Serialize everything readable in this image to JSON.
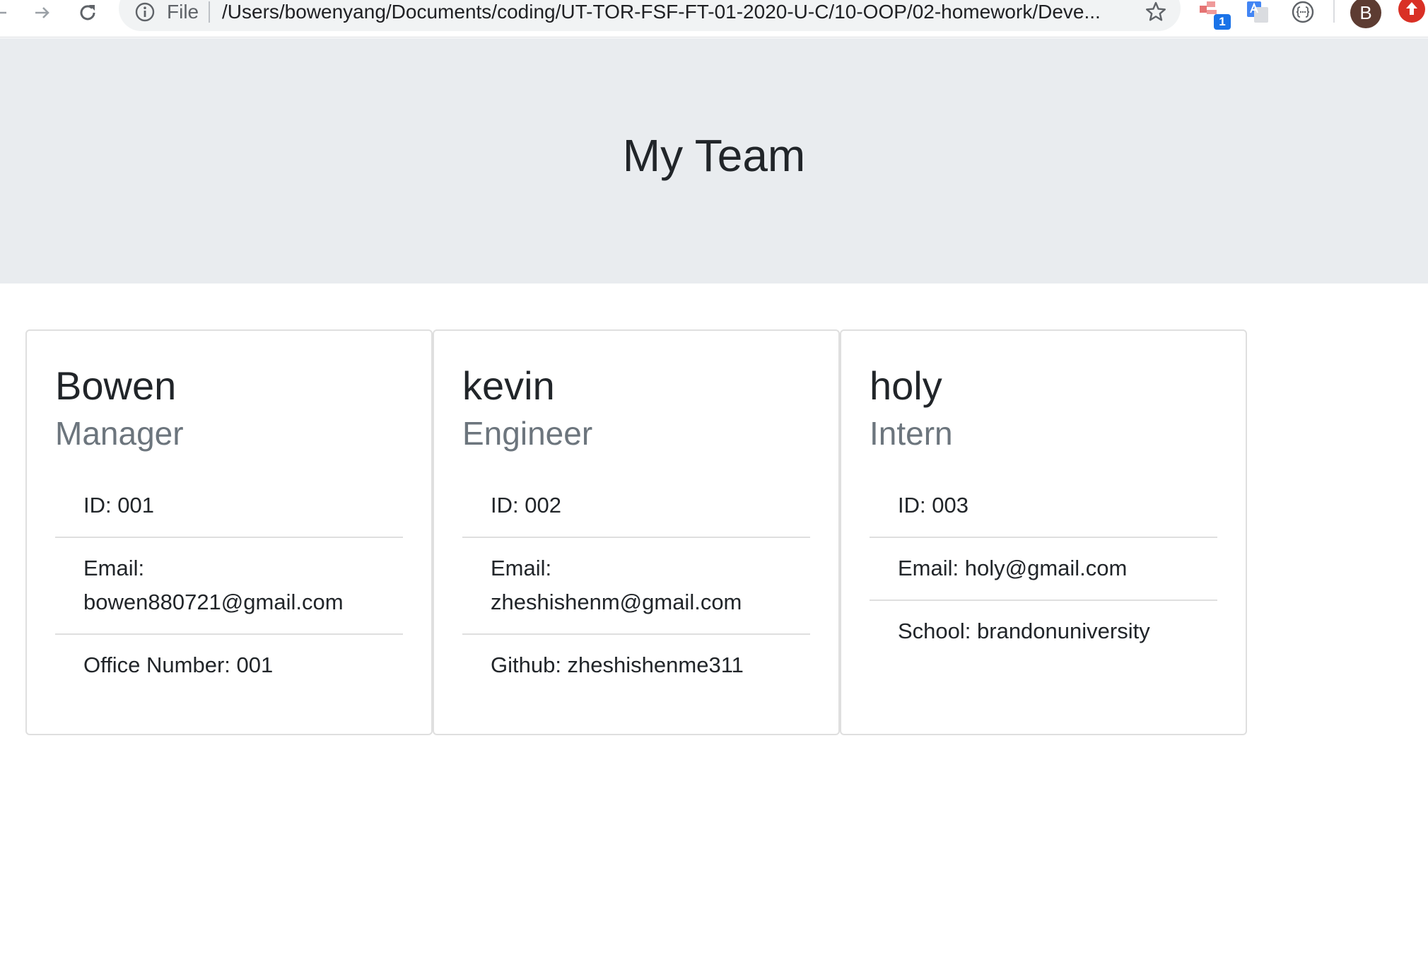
{
  "browser": {
    "scheme_label": "File",
    "url": "/Users/bowenyang/Documents/coding/UT-TOR-FSF-FT-01-2020-U-C/10-OOP/02-homework/Deve...",
    "extension_badge": "1",
    "profile_initial": "B",
    "icons": [
      "back-arrow-icon",
      "forward-arrow-icon",
      "reload-icon",
      "info-icon",
      "star-icon",
      "extension-icon",
      "translate-icon",
      "json-icon",
      "update-icon"
    ]
  },
  "header": {
    "title": "My Team"
  },
  "team": [
    {
      "name": "Bowen",
      "role": "Manager",
      "details": [
        "ID: 001",
        "Email: bowen880721@gmail.com",
        "Office Number: 001"
      ]
    },
    {
      "name": "kevin",
      "role": "Engineer",
      "details": [
        "ID: 002",
        "Email: zheshishenm@gmail.com",
        "Github: zheshishenme311"
      ]
    },
    {
      "name": "holy",
      "role": "Intern",
      "details": [
        "ID: 003",
        "Email: holy@gmail.com",
        "School: brandonuniversity"
      ]
    }
  ],
  "colors": {
    "jumbotron_bg": "#e9ecef",
    "role_text": "#6c757d",
    "body_text": "#212529",
    "card_border": "#dfdfdf"
  }
}
